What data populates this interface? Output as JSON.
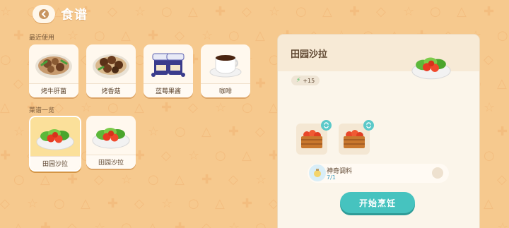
{
  "header": {
    "title": "食谱",
    "back_icon": "back-arrow-icon"
  },
  "recent": {
    "label": "最近使用",
    "items": [
      {
        "label": "烤牛肝菌",
        "icon": "grilled-porcini-icon"
      },
      {
        "label": "烤香菇",
        "icon": "grilled-shiitake-icon"
      },
      {
        "label": "蓝莓果酱",
        "icon": "blueberry-jam-icon"
      },
      {
        "label": "咖啡",
        "icon": "coffee-icon"
      }
    ]
  },
  "recipes": {
    "label": "菜谱一览",
    "items": [
      {
        "label": "田园沙拉",
        "icon": "garden-salad-icon",
        "selected": true
      },
      {
        "label": "田园沙拉",
        "icon": "garden-salad-icon",
        "selected": false
      }
    ]
  },
  "detail": {
    "title": "田园沙拉",
    "energy": "+15",
    "ingredients": [
      {
        "icon": "tomato-crate-icon"
      },
      {
        "icon": "tomato-crate-icon"
      }
    ],
    "special": {
      "name": "神奇调料",
      "count": "7/1"
    },
    "cook_button": "开始烹饪"
  },
  "colors": {
    "accent": "#46c3bf",
    "background": "#f6c98e",
    "panel": "#fbf5ea"
  }
}
